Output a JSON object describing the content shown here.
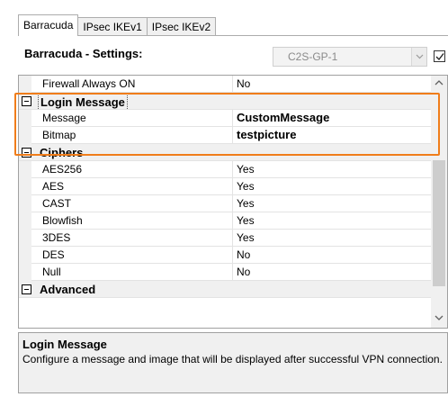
{
  "tabs": [
    {
      "label": "Barracuda",
      "active": true
    },
    {
      "label": "IPsec IKEv1",
      "active": false
    },
    {
      "label": "IPsec IKEv2",
      "active": false
    }
  ],
  "settings": {
    "label": "Barracuda - Settings:",
    "profile_value": "C2S-GP-1",
    "checkbox_checked": true
  },
  "grid": {
    "partial_row": {
      "name": "Firewall Always ON",
      "value": "No"
    },
    "categories": {
      "login_message": {
        "label": "Login Message",
        "rows": [
          {
            "name": "Message",
            "value": "CustomMessage"
          },
          {
            "name": "Bitmap",
            "value": "testpicture"
          }
        ]
      },
      "ciphers": {
        "label": "Ciphers",
        "rows": [
          {
            "name": "AES256",
            "value": "Yes"
          },
          {
            "name": "AES",
            "value": "Yes"
          },
          {
            "name": "CAST",
            "value": "Yes"
          },
          {
            "name": "Blowfish",
            "value": "Yes"
          },
          {
            "name": "3DES",
            "value": "Yes"
          },
          {
            "name": "DES",
            "value": "No"
          },
          {
            "name": "Null",
            "value": "No"
          }
        ]
      },
      "advanced": {
        "label": "Advanced"
      }
    }
  },
  "description": {
    "title": "Login Message",
    "text": "Configure a message and image that will be displayed after successful VPN connection."
  },
  "colors": {
    "highlight": "#f07d1a",
    "category_bg": "#f0f0f0",
    "grid_border": "#a0a0a0"
  },
  "icons": {
    "collapse": "collapse-minus-icon",
    "scroll_up": "chevron-up-icon",
    "scroll_down": "chevron-down-icon",
    "dropdown": "chevron-down-icon",
    "check": "checkmark-icon"
  }
}
